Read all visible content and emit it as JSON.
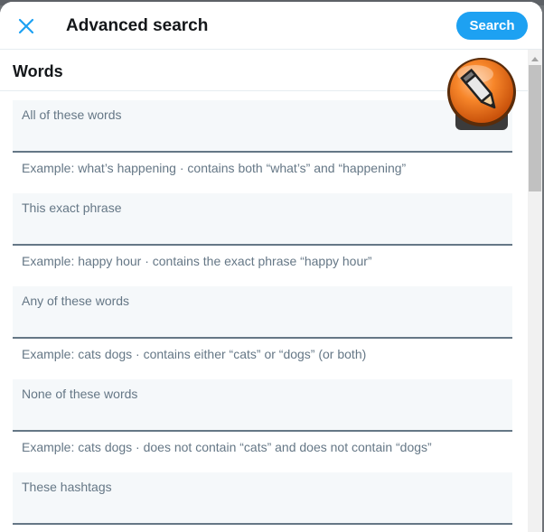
{
  "header": {
    "title": "Advanced search",
    "search_label": "Search"
  },
  "section": {
    "heading": "Words"
  },
  "fields": [
    {
      "label": "All of these words",
      "value": "",
      "hint": "Example: what’s happening · contains both “what’s” and “happening”"
    },
    {
      "label": "This exact phrase",
      "value": "",
      "hint": "Example: happy hour · contains the exact phrase “happy hour”"
    },
    {
      "label": "Any of these words",
      "value": "",
      "hint": "Example: cats dogs · contains either “cats” or “dogs” (or both)"
    },
    {
      "label": "None of these words",
      "value": "",
      "hint": "Example: cats dogs · does not contain “cats” and does not contain “dogs”"
    },
    {
      "label": "These hashtags",
      "value": "",
      "hint": ""
    }
  ],
  "colors": {
    "accent": "#1da1f2",
    "text_primary": "#14171a",
    "text_secondary": "#657786",
    "field_bg": "#f5f8fa"
  },
  "icons": {
    "close": "close-icon",
    "pencil_badge": "pencil-edit-icon"
  }
}
